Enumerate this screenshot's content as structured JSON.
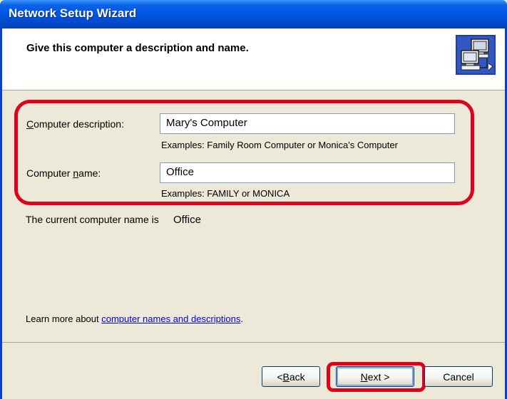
{
  "window": {
    "title": "Network Setup Wizard"
  },
  "header": {
    "heading": "Give this computer a description and name.",
    "icon": "network-computers-icon"
  },
  "form": {
    "description": {
      "label_accesskey": "C",
      "label_rest": "omputer description:",
      "value": "Mary's Computer",
      "hint": "Examples: Family Room Computer or Monica's Computer"
    },
    "name": {
      "label_pre": "Computer ",
      "label_accesskey": "n",
      "label_rest": "ame:",
      "value": "Office",
      "hint": "Examples: FAMILY or MONICA"
    }
  },
  "current_name": {
    "label": "The current computer name is",
    "value": "Office"
  },
  "learn_more": {
    "text": "Learn more about",
    "link": "computer names and descriptions",
    "suffix": "."
  },
  "buttons": {
    "back": {
      "prefix": "< ",
      "accesskey": "B",
      "rest": "ack"
    },
    "next": {
      "accesskey": "N",
      "rest": "ext >"
    },
    "cancel": {
      "label": "Cancel"
    }
  },
  "colors": {
    "highlight": "#e0001b",
    "titlebar": "#0054e3",
    "dialog_bg": "#ece9d8",
    "link": "#0000ee"
  }
}
